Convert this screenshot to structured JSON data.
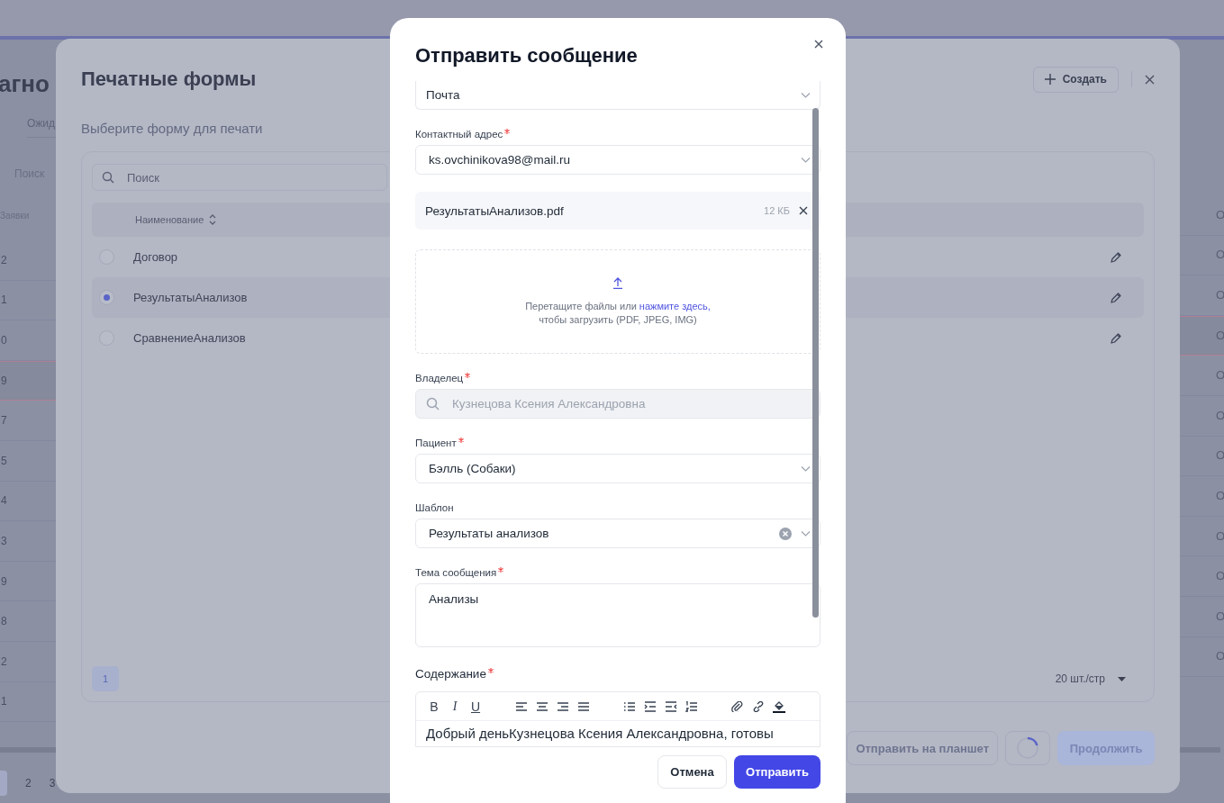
{
  "background_page": {
    "heading": "агно",
    "tab": "Ожид",
    "search_placeholder": "Поиск",
    "column_header": "Заявки",
    "rows": [
      {
        "column_1": "2",
        "column_2": "О",
        "highlighted": false
      },
      {
        "column_1": "1",
        "column_2": "О",
        "highlighted": false
      },
      {
        "column_1": "0",
        "column_2": "О",
        "highlighted": false
      },
      {
        "column_1": "9",
        "column_2": "О",
        "highlighted": true
      },
      {
        "column_1": "7",
        "column_2": "О",
        "highlighted": false
      },
      {
        "column_1": "5",
        "column_2": "О",
        "highlighted": false
      },
      {
        "column_1": "4",
        "column_2": "О",
        "highlighted": false
      },
      {
        "column_1": "3",
        "column_2": "О",
        "highlighted": false
      },
      {
        "column_1": "9",
        "column_2": "О",
        "highlighted": false
      },
      {
        "column_1": "8",
        "column_2": "О",
        "highlighted": false
      },
      {
        "column_1": "2",
        "column_2": "О",
        "highlighted": false
      },
      {
        "column_1": "1",
        "column_2": "О",
        "highlighted": false
      }
    ],
    "pagination": [
      {
        "label": "2",
        "selected": false
      },
      {
        "label": "3",
        "selected": false
      }
    ]
  },
  "print_forms": {
    "title": "Печатные формы",
    "subtitle": "Выберите форму для печати",
    "create_button": "Создать",
    "search": {
      "placeholder": "Поиск"
    },
    "table": {
      "columns": [
        "Наименование"
      ],
      "rows": [
        {
          "name": "Договор",
          "selected": false
        },
        {
          "name": "РезультатыАнализов",
          "selected": true
        },
        {
          "name": "СравнениеАнализов",
          "selected": false
        }
      ]
    },
    "pagination": {
      "pages": [
        {
          "label": "1",
          "selected": true
        }
      ],
      "page_size": "20 шт./стр"
    },
    "buttons": [
      {
        "label": "Отправить на планшет",
        "kind": "secondary"
      },
      {
        "kind": "loading"
      },
      {
        "label": "Продолжить",
        "kind": "primary"
      }
    ]
  },
  "send_message": {
    "title": "Отправить сообщение",
    "items": [
      {
        "kind": "select",
        "value": "Почта"
      },
      {
        "kind": "select",
        "label": "Контактный адрес",
        "required": true,
        "value": "ks.ovchinikova98@mail.ru"
      },
      {
        "kind": "attachment",
        "name": "РезультатыАнализов.pdf",
        "size": "12 КБ"
      },
      {
        "kind": "upload",
        "text_before": "Перетащите файлы или",
        "link": "нажмите здесь,",
        "text_after": "чтобы загрузить (PDF, JPEG, IMG)"
      },
      {
        "kind": "search",
        "label": "Владелец",
        "required": true,
        "value": "Кузнецова Ксения Александровна",
        "disabled": true
      },
      {
        "kind": "select",
        "label": "Пациент",
        "required": true,
        "value": "Бэлль (Собаки)"
      },
      {
        "kind": "select",
        "label": "Шаблон",
        "required": false,
        "value": "Результаты анализов",
        "clearable": true
      },
      {
        "kind": "textarea",
        "label": "Тема сообщения",
        "required": true,
        "value": "Анализы"
      }
    ],
    "content": {
      "label": "Содержание",
      "required": true,
      "format_buttons": [
        "B",
        "I",
        "U"
      ],
      "text": "Добрый деньКузнецова Ксения Александровна, готовы"
    },
    "buttons": [
      {
        "label": "Отмена",
        "kind": "secondary"
      },
      {
        "label": "Отправить",
        "kind": "primary"
      }
    ]
  }
}
